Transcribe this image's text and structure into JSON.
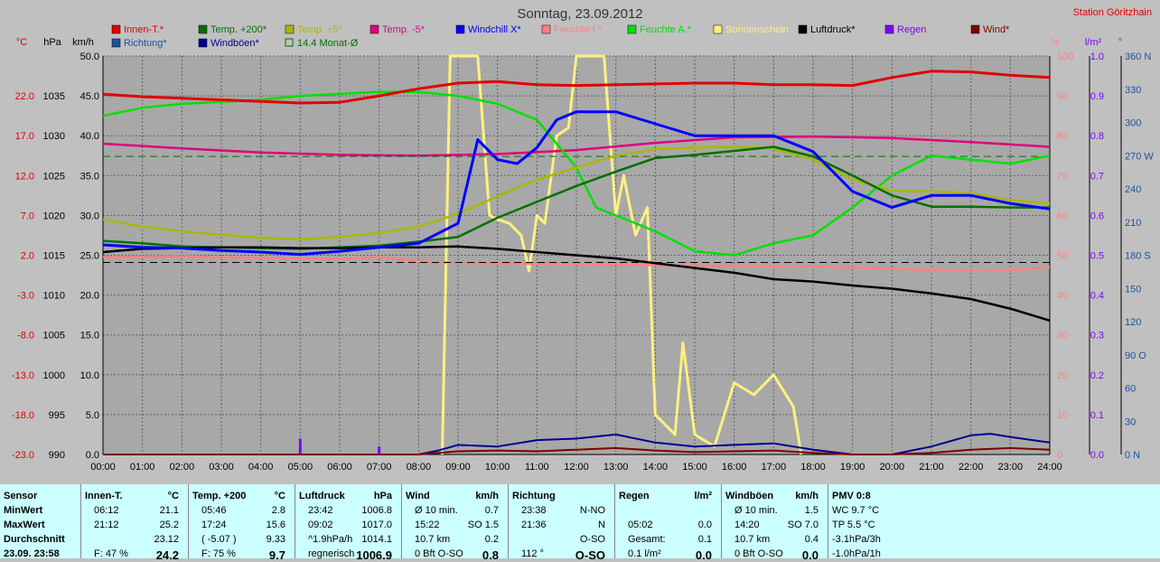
{
  "header": {
    "title": "Sonntag, 23.09.2012",
    "station": "Station Göritzhain"
  },
  "legend": [
    {
      "label": "Innen-T.*",
      "color": "#e00000"
    },
    {
      "label": "Temp. +200*",
      "color": "#007000"
    },
    {
      "label": "Temp. +5*",
      "color": "#a8b800"
    },
    {
      "label": "Temp. -5*",
      "color": "#e0007a"
    },
    {
      "label": "Windchill X*",
      "color": "#0000ff"
    },
    {
      "label": "Feuchte I.*",
      "color": "#ff8080"
    },
    {
      "label": "Feuchte A.*",
      "color": "#00e000"
    },
    {
      "label": "Sonnenschein",
      "color": "#fff080"
    },
    {
      "label": "Luftdruck*",
      "color": "#000000"
    },
    {
      "label": "Regen",
      "color": "#8000ff"
    },
    {
      "label": "Wind*",
      "color": "#800000"
    },
    {
      "label": "Richtung*",
      "color": "#2050a0"
    },
    {
      "label": "Windböen*",
      "color": "#000090"
    },
    {
      "label": "14.4 Monat-Ø",
      "color": "#007000"
    }
  ],
  "axes": {
    "units": {
      "temp": "°C",
      "press": "hPa",
      "speed": "km/h",
      "humid": "%",
      "rain": "l/m²",
      "dir": "°"
    },
    "temp_ticks": [
      "22.0",
      "17.0",
      "12.0",
      "7.0",
      "2.0",
      "-3.0",
      "-8.0",
      "-13.0",
      "-18.0",
      "-23.0"
    ],
    "press_ticks": [
      "1035",
      "1030",
      "1025",
      "1020",
      "1015",
      "1010",
      "1005",
      "1000",
      "995",
      "990"
    ],
    "speed_ticks": [
      "50.0",
      "45.0",
      "40.0",
      "35.0",
      "30.0",
      "25.0",
      "20.0",
      "15.0",
      "10.0",
      "5.0",
      "0.0"
    ],
    "humid_ticks": [
      "100",
      "90",
      "80",
      "70",
      "60",
      "50",
      "40",
      "30",
      "20",
      "10",
      "0"
    ],
    "rain_ticks": [
      "1.0",
      "0.9",
      "0.8",
      "0.7",
      "0.6",
      "0.5",
      "0.4",
      "0.3",
      "0.2",
      "0.1",
      "0.0"
    ],
    "dir_ticks": [
      "360 N",
      "330",
      "300",
      "270 W",
      "240",
      "210",
      "180 S",
      "150",
      "120",
      "90 O",
      "60",
      "30",
      "0 N"
    ],
    "x_ticks": [
      "00:00",
      "01:00",
      "02:00",
      "03:00",
      "04:00",
      "05:00",
      "06:00",
      "07:00",
      "08:00",
      "09:00",
      "10:00",
      "11:00",
      "12:00",
      "13:00",
      "14:00",
      "15:00",
      "16:00",
      "17:00",
      "18:00",
      "19:00",
      "20:00",
      "21:00",
      "22:00",
      "23:00",
      "24:00"
    ]
  },
  "chart_data": {
    "type": "line",
    "title": "Sonntag, 23.09.2012",
    "x_unit": "hour",
    "xlim": [
      0,
      24
    ],
    "grid": true,
    "series": [
      {
        "name": "Innen-T.*",
        "axis": "temp",
        "color": "#e00000",
        "x": [
          0,
          1,
          2,
          3,
          4,
          5,
          6,
          7,
          8,
          9,
          10,
          11,
          12,
          13,
          14,
          15,
          16,
          17,
          18,
          19,
          20,
          21,
          22,
          23,
          24
        ],
        "y": [
          22.2,
          21.9,
          21.7,
          21.5,
          21.3,
          21.1,
          21.2,
          22.0,
          22.9,
          23.6,
          23.8,
          23.4,
          23.3,
          23.4,
          23.5,
          23.6,
          23.6,
          23.4,
          23.4,
          23.3,
          24.3,
          25.1,
          25.0,
          24.6,
          24.3
        ]
      },
      {
        "name": "Temp. +200*",
        "axis": "temp",
        "color": "#007000",
        "x": [
          0,
          1,
          2,
          3,
          4,
          5,
          6,
          7,
          8,
          9,
          10,
          11,
          12,
          13,
          14,
          15,
          16,
          17,
          18,
          19,
          20,
          21,
          22,
          23,
          24
        ],
        "y": [
          3.8,
          3.5,
          3.1,
          3.0,
          2.9,
          2.8,
          3.0,
          3.2,
          3.7,
          4.3,
          6.7,
          8.7,
          10.7,
          12.5,
          14.2,
          14.6,
          15.1,
          15.6,
          14.4,
          12.0,
          9.5,
          8.1,
          8.1,
          8.0,
          8.0
        ]
      },
      {
        "name": "Temp. +5*",
        "axis": "temp",
        "color": "#a8b800",
        "x": [
          0,
          1,
          2,
          3,
          4,
          5,
          6,
          7,
          8,
          9,
          10,
          11,
          12,
          13,
          14,
          15,
          16,
          17,
          18,
          19,
          20,
          21,
          22,
          23,
          24
        ],
        "y": [
          6.5,
          5.6,
          5.0,
          4.6,
          4.2,
          4.0,
          4.3,
          4.8,
          5.6,
          7.2,
          9.4,
          11.5,
          13.0,
          14.5,
          15.3,
          15.5,
          15.6,
          15.4,
          14.0,
          11.5,
          10.1,
          10.0,
          9.8,
          8.9,
          8.5
        ]
      },
      {
        "name": "Temp. -5*",
        "axis": "temp",
        "color": "#e0007a",
        "x": [
          0,
          2,
          4,
          6,
          8,
          10,
          12,
          14,
          16,
          18,
          20,
          22,
          24
        ],
        "y": [
          16.0,
          15.4,
          14.9,
          14.6,
          14.5,
          14.7,
          15.2,
          16.1,
          16.8,
          16.9,
          16.7,
          16.2,
          15.6
        ]
      },
      {
        "name": "Windchill X*",
        "axis": "temp",
        "color": "#0000ff",
        "x": [
          0,
          1,
          2,
          3,
          4,
          5,
          6,
          7,
          8,
          9,
          9.5,
          10,
          10.5,
          11,
          11.5,
          12,
          13,
          14,
          15,
          16,
          17,
          18,
          19,
          20,
          21,
          22,
          23,
          24
        ],
        "y": [
          3.3,
          3.0,
          2.9,
          2.6,
          2.4,
          2.1,
          2.5,
          3.0,
          3.5,
          6.0,
          16.5,
          14.0,
          13.5,
          15.5,
          19.0,
          20.0,
          20.0,
          18.5,
          17.0,
          17.0,
          17.0,
          15.0,
          10.0,
          8.0,
          9.5,
          9.5,
          8.5,
          7.8
        ]
      },
      {
        "name": "Feuchte I.*",
        "axis": "humid",
        "color": "#ff8080",
        "x": [
          0,
          2,
          4,
          6,
          7,
          8,
          10,
          12,
          14,
          16,
          18,
          20,
          22,
          23,
          24
        ],
        "y": [
          49.6,
          49.7,
          49.3,
          49.1,
          49.6,
          48.4,
          47.9,
          47.8,
          47.5,
          47.3,
          47.2,
          46.6,
          46.0,
          46.2,
          47.0
        ]
      },
      {
        "name": "Feuchte A.*",
        "axis": "humid",
        "color": "#00e000",
        "x": [
          0,
          1,
          2,
          3,
          4,
          5,
          6,
          7,
          8,
          9,
          10,
          11,
          12,
          12.5,
          13,
          14,
          15,
          16,
          17,
          18,
          19,
          20,
          21,
          22,
          23,
          24
        ],
        "y": [
          85.0,
          87.0,
          88.0,
          88.5,
          89.0,
          90.0,
          90.5,
          91.0,
          91.0,
          90.0,
          88.0,
          84.0,
          72.0,
          62.0,
          60.0,
          56.0,
          51.0,
          50.0,
          53.0,
          55.0,
          62.0,
          70.0,
          75.0,
          74.0,
          73.0,
          75.0
        ]
      },
      {
        "name": "Sonnenschein",
        "axis": "humid",
        "color": "#fff080",
        "x": [
          8.6,
          8.8,
          9.0,
          9.5,
          9.8,
          10.0,
          10.3,
          10.6,
          10.8,
          11.0,
          11.2,
          11.5,
          11.8,
          12.0,
          12.5,
          12.7,
          13.0,
          13.2,
          13.5,
          13.8,
          14.0,
          14.5,
          14.7,
          15.0,
          15.5,
          16.0,
          16.5,
          17.0,
          17.5,
          17.7
        ],
        "y": [
          0,
          100,
          100,
          100,
          60,
          59,
          58,
          55,
          46,
          60,
          58,
          80,
          82,
          100,
          100,
          100,
          60,
          70,
          55,
          62,
          10,
          5,
          28,
          5,
          2,
          18,
          15,
          20,
          12,
          0
        ]
      },
      {
        "name": "Luftdruck*",
        "axis": "press",
        "color": "#000000",
        "x": [
          0,
          1,
          2,
          3,
          4,
          5,
          6,
          7,
          8,
          9,
          10,
          11,
          12,
          13,
          14,
          15,
          16,
          17,
          18,
          19,
          20,
          21,
          22,
          23,
          24
        ],
        "y": [
          1015.4,
          1015.8,
          1015.9,
          1016.0,
          1016.0,
          1015.9,
          1015.9,
          1016.0,
          1016.0,
          1016.1,
          1015.8,
          1015.4,
          1015.0,
          1014.6,
          1014.0,
          1013.4,
          1012.8,
          1012.0,
          1011.7,
          1011.2,
          1010.8,
          1010.2,
          1009.5,
          1008.3,
          1006.8
        ]
      },
      {
        "name": "Wind*",
        "axis": "speed",
        "color": "#800000",
        "x": [
          0,
          8,
          9,
          10,
          11,
          12,
          13,
          14,
          15,
          16,
          17,
          18,
          19,
          20,
          21,
          22,
          23,
          24
        ],
        "y": [
          0,
          0,
          0.4,
          0.5,
          0.4,
          0.6,
          0.8,
          0.5,
          0.3,
          0.4,
          0.5,
          0.2,
          0,
          0,
          0.2,
          0.6,
          0.8,
          0.6
        ]
      },
      {
        "name": "Windböen*",
        "axis": "speed",
        "color": "#000090",
        "x": [
          0,
          8,
          8.5,
          9,
          10,
          11,
          12,
          13,
          14,
          15,
          16,
          17,
          18,
          19,
          20,
          21,
          22,
          22.5,
          23,
          24
        ],
        "y": [
          0,
          0,
          0.5,
          1.2,
          1.0,
          1.8,
          2.0,
          2.5,
          1.5,
          1.0,
          1.2,
          1.4,
          0.6,
          0,
          0,
          1.0,
          2.4,
          2.6,
          2.2,
          1.5
        ]
      },
      {
        "name": "14.4 Monat-Ø",
        "axis": "temp",
        "color": "#007000",
        "dashed": true,
        "x": [
          0,
          24
        ],
        "y": [
          14.4,
          14.4
        ]
      }
    ],
    "rain_bars": {
      "name": "Regen",
      "axis": "rain",
      "color": "#8000ff",
      "x": [
        5.0,
        7.0
      ],
      "values": [
        0.04,
        0.02
      ]
    }
  },
  "table": {
    "sensor": {
      "title": "Sensor",
      "rows": [
        "MinWert",
        "MaxWert",
        "Durchschnitt",
        "23.09. 23:58"
      ]
    },
    "innen": {
      "title": "Innen-T.",
      "unit": "°C",
      "rows": [
        [
          "06:12",
          "21.1"
        ],
        [
          "21:12",
          "25.2"
        ],
        [
          "",
          "23.12"
        ],
        [
          "F: 47 %",
          "24.2"
        ]
      ]
    },
    "temp": {
      "title": "Temp. +200",
      "unit": "°C",
      "rows": [
        [
          "05:46",
          "2.8"
        ],
        [
          "17:24",
          "15.6"
        ],
        [
          "( -5.07 )",
          "9.33"
        ],
        [
          "F: 75 %",
          "9.7"
        ]
      ]
    },
    "druck": {
      "title": "Luftdruck",
      "unit": "hPa",
      "rows": [
        [
          "23:42",
          "1006.8"
        ],
        [
          "09:02",
          "1017.0"
        ],
        [
          "^1.9hPa/h",
          "1014.1"
        ],
        [
          "regnerisch ↓",
          "1006.9"
        ]
      ]
    },
    "wind": {
      "title": "Wind",
      "unit": "km/h",
      "rows": [
        [
          "Ø 10 min.",
          "0.7"
        ],
        [
          "15:22",
          "SO 1.5"
        ],
        [
          "10.7 km",
          "0.2"
        ],
        [
          "0 Bft O-SO",
          "0.8"
        ]
      ]
    },
    "richtung": {
      "title": "Richtung",
      "unit": "",
      "rows": [
        [
          "23:38",
          "N-NO"
        ],
        [
          "21:36",
          "N"
        ],
        [
          "",
          "O-SO"
        ],
        [
          "112 °",
          "O-SO"
        ]
      ]
    },
    "regen": {
      "title": "Regen",
      "unit": "l/m²",
      "rows": [
        [
          "",
          ""
        ],
        [
          "05:02",
          "0.0"
        ],
        [
          "Gesamt:",
          "0.1"
        ],
        [
          "0.1 l/m²",
          "0.0"
        ]
      ]
    },
    "boeen": {
      "title": "Windböen",
      "unit": "km/h",
      "rows": [
        [
          "Ø 10 min.",
          "1.5"
        ],
        [
          "14:20",
          "SO 7.0"
        ],
        [
          "10.7 km",
          "0.4"
        ],
        [
          "0 Bft O-SO",
          "0.0"
        ]
      ]
    },
    "pmv": {
      "title": "PMV 0:8",
      "rows": [
        "WC 9.7 °C",
        "TP 5.5 °C",
        "-3.1hPa/3h",
        "-1.0hPa/1h"
      ]
    }
  }
}
